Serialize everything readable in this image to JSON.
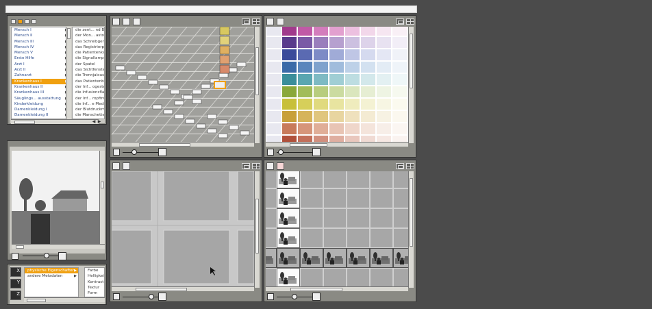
{
  "categories": {
    "items": [
      {
        "label": "Mensch I"
      },
      {
        "label": "Mensch II"
      },
      {
        "label": "Mensch III"
      },
      {
        "label": "Mensch IV"
      },
      {
        "label": "Mensch V"
      },
      {
        "label": "Erste Hilfe"
      },
      {
        "label": "Arzt I"
      },
      {
        "label": "Arzt II"
      },
      {
        "label": "Zahnarzt"
      },
      {
        "label": "Krankenhaus I"
      },
      {
        "label": "Krankenhaus II"
      },
      {
        "label": "Krankenhaus III"
      },
      {
        "label": "Säuglings... ausstattung"
      },
      {
        "label": "Kinderkleidung"
      },
      {
        "label": "Damenkleidung I"
      },
      {
        "label": "Damenkleidung II"
      }
    ],
    "selected_index": 9
  },
  "items": [
    {
      "label": "die zent... nd Blut"
    },
    {
      "label": "der Mon... astonn"
    },
    {
      "label": "das Schreibgerät"
    },
    {
      "label": "das Registrierpap"
    },
    {
      "label": "die Patientenkarte"
    },
    {
      "label": "die Signallampen"
    },
    {
      "label": "der Spatel"
    },
    {
      "label": "das Sichtfenster"
    },
    {
      "label": "die Trennjalousie"
    },
    {
      "label": "das Patientenbett"
    },
    {
      "label": "der Inf... ogestell"
    },
    {
      "label": "die Infusionsflasch"
    },
    {
      "label": "der Inf... ropfinfu"
    },
    {
      "label": "die Inf... e Medika"
    },
    {
      "label": "der Blutdruckmes"
    },
    {
      "label": "die Manschette"
    }
  ],
  "metadata": {
    "items": [
      {
        "label": "physische Eigenschaften"
      },
      {
        "label": "andere Metadaten"
      }
    ],
    "selected_index": 0,
    "properties": [
      {
        "label": "Farbe"
      },
      {
        "label": "Helligkeit"
      },
      {
        "label": "Kontrast"
      },
      {
        "label": "Textur"
      },
      {
        "label": "Form"
      }
    ]
  },
  "axis_buttons": [
    {
      "label": "X"
    },
    {
      "label": "Y"
    },
    {
      "label": "Z"
    }
  ],
  "colors": {
    "accent": "#f0a010",
    "swatch_rows": [
      [
        "#a13a8c",
        "#c05aa6",
        "#d37dbc",
        "#e2a0cf",
        "#ecc0e0",
        "#f2d7ea",
        "#f6e6f1",
        "#f9f0f6"
      ],
      [
        "#5a3b8c",
        "#7a5aa6",
        "#9a7ebc",
        "#b6a0cf",
        "#ccc0e0",
        "#ddd3ea",
        "#e8e2f1",
        "#f2eef7"
      ],
      [
        "#3a4a9a",
        "#5a6ab2",
        "#7d8bc6",
        "#a0abd7",
        "#bfc6e5",
        "#d5daef",
        "#e4e7f4",
        "#f0f2f8"
      ],
      [
        "#3a6aa8",
        "#5a86bc",
        "#7ea2cd",
        "#a0bcdc",
        "#bdd1e8",
        "#d3e1f0",
        "#e3ecf5",
        "#eff4f9"
      ],
      [
        "#3a8e9a",
        "#5aa6b0",
        "#7ebac3",
        "#a0ced4",
        "#bddde1",
        "#d3e8eb",
        "#e3f0f2",
        "#eff7f8"
      ],
      [
        "#8aa83a",
        "#a2bc5a",
        "#b8cd7e",
        "#cbdba0",
        "#dae6bd",
        "#e6eed3",
        "#eef4e3",
        "#f6f9ef"
      ],
      [
        "#c8c03a",
        "#d6cf5a",
        "#e0da7e",
        "#e8e4a0",
        "#efecbd",
        "#f4f2d3",
        "#f7f6e3",
        "#fbfaef"
      ],
      [
        "#c8a03a",
        "#d6b45a",
        "#e0c67e",
        "#e8d5a0",
        "#efe1bd",
        "#f4ebd3",
        "#f7f2e3",
        "#fbf8ef"
      ],
      [
        "#c87a5a",
        "#d6957a",
        "#e0ae98",
        "#e8c4b4",
        "#efd6ca",
        "#f4e4db",
        "#f7eee8",
        "#fbf6f2"
      ],
      [
        "#b0503a",
        "#c26f5a",
        "#d18f7e",
        "#dfaea0",
        "#e9c7bd",
        "#f0dad3",
        "#f6e8e3",
        "#faf3f0"
      ]
    ]
  }
}
